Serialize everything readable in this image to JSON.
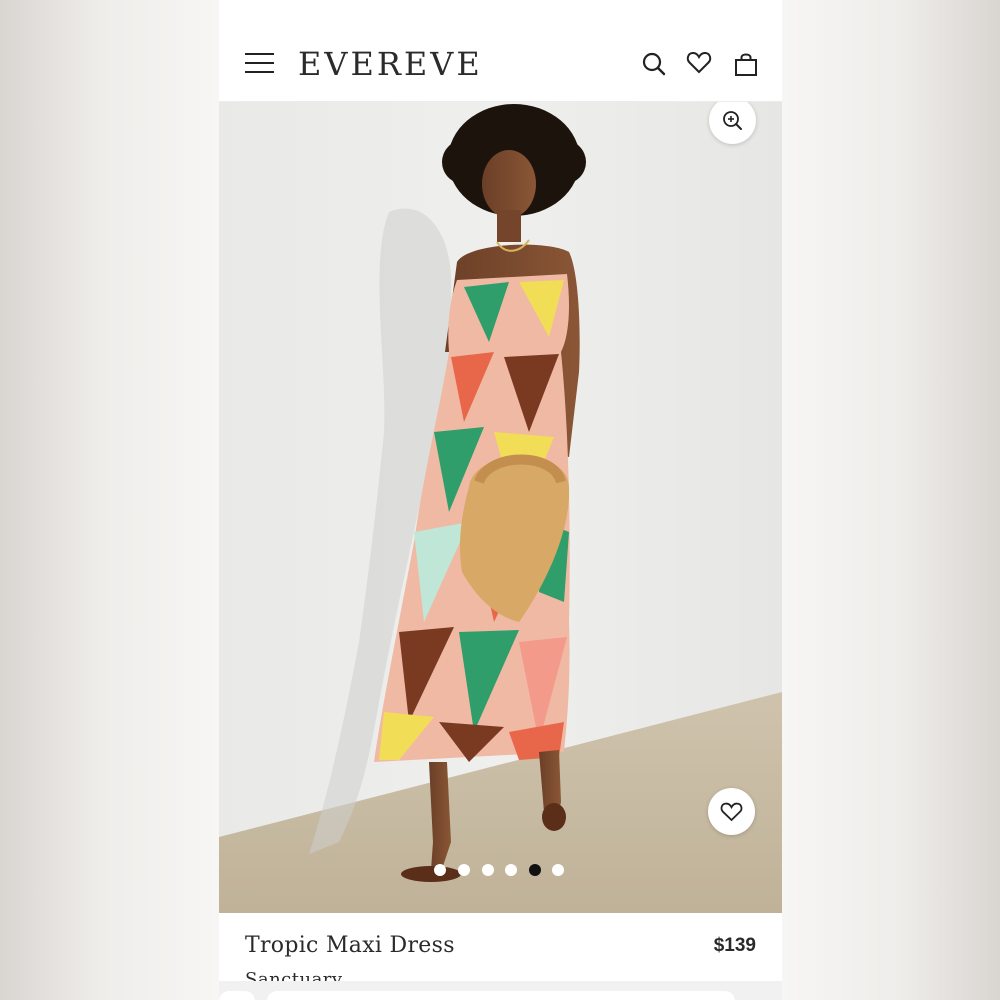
{
  "header": {
    "logo": "EVEREVE",
    "icons": [
      "menu-icon",
      "search-icon",
      "heart-icon",
      "bag-icon"
    ]
  },
  "product": {
    "name": "Tropic Maxi Dress",
    "price": "$139",
    "brand": "Sanctuary"
  },
  "gallery": {
    "image_count": 6,
    "active_index": 4,
    "zoom_icon": "zoom-in-icon",
    "favorite_icon": "heart-icon"
  },
  "colors": {
    "text": "#2a2a2a",
    "active_dot": "#111111",
    "inactive_dot": "#ffffff",
    "dress_palette": [
      "#e8674a",
      "#2f9e6b",
      "#f2dd57",
      "#7a3a22",
      "#f39a8b",
      "#bfe6d6"
    ]
  }
}
